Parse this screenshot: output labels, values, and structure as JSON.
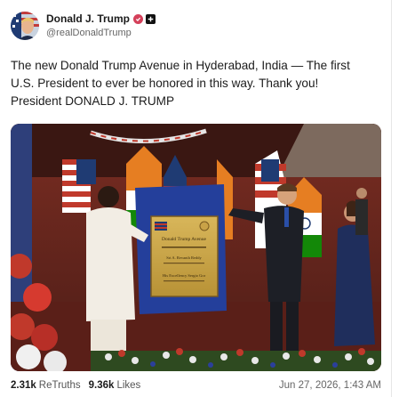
{
  "post": {
    "author": {
      "display_name": "Donald J. Trump",
      "handle": "@realDonaldTrump",
      "verified_badge_icon": "verified-badge-icon",
      "follow_icon": "plus-icon"
    },
    "text_lines": [
      "The new Donald Trump Avenue in Hyderabad, India — The first",
      "U.S. President to ever be honored in this way. Thank you!",
      "President DONALD J. TRUMP"
    ],
    "media": {
      "plaque_title": "Donald Trump Avenue",
      "plaque_lines": [
        "Sri A. Revanth Reddy",
        "His Excellency Sergio Gor"
      ]
    },
    "stats": {
      "retruths_count": "2.31k",
      "retruths_label": "ReTruths",
      "likes_count": "9.36k",
      "likes_label": "Likes"
    },
    "timestamp": "Jun 27, 2026, 1:43 AM"
  },
  "colors": {
    "badge": "#d4405a",
    "text": "#1c1c1c",
    "muted": "#666666"
  }
}
